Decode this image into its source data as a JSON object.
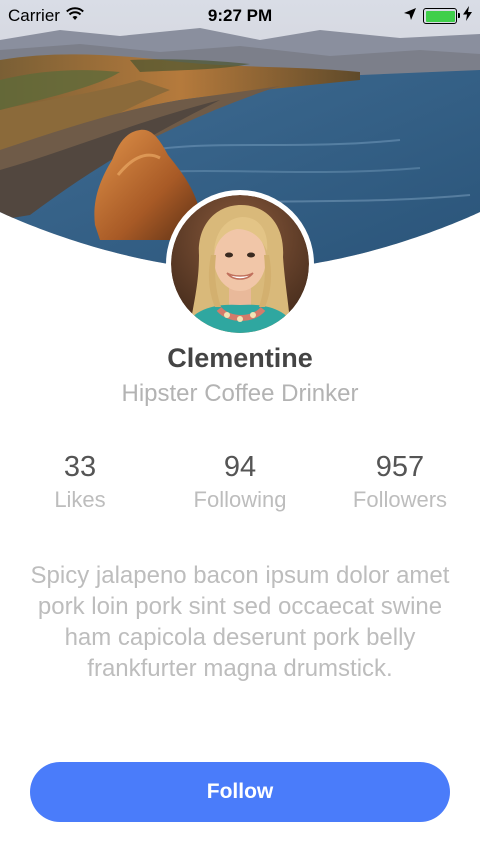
{
  "status_bar": {
    "carrier": "Carrier",
    "time": "9:27 PM",
    "battery_level": 1.0,
    "battery_color": "#3fcf4a"
  },
  "profile": {
    "name": "Clementine",
    "subtitle": "Hipster Coffee Drinker",
    "bio": "Spicy jalapeno bacon ipsum dolor amet pork loin pork sint sed occaecat swine ham capicola deserunt pork belly frankfurter magna drumstick."
  },
  "stats": [
    {
      "value": "33",
      "label": "Likes"
    },
    {
      "value": "94",
      "label": "Following"
    },
    {
      "value": "957",
      "label": "Followers"
    }
  ],
  "follow_button": {
    "label": "Follow",
    "color": "#4a7cfa"
  },
  "icons": {
    "wifi": "wifi-icon",
    "location": "location-arrow-icon",
    "battery": "battery-icon",
    "charging": "charging-bolt-icon"
  }
}
